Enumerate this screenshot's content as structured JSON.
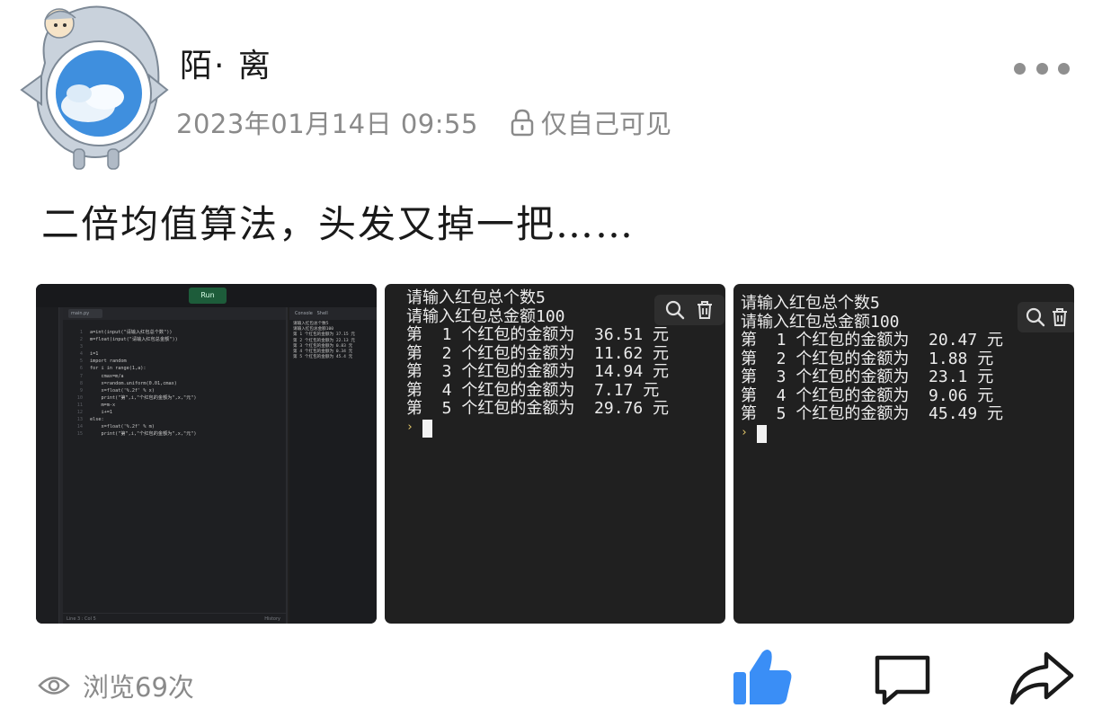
{
  "post": {
    "author": "陌· 离",
    "time": "2023年01月14日 09:55",
    "privacy": "仅自己可见",
    "text": "二倍均值算法，头发又掉一把……",
    "views": "浏览69次"
  },
  "images": {
    "ide": {
      "run_label": "Run",
      "tab": "main.py",
      "status_left": "Line 3 : Col 5",
      "status_right": "History",
      "console_tabs": "Console   Shell",
      "code_lines": [
        "a=int(input(\"请输入红包总个数\"))",
        "m=float(input(\"请输入红包总金额\"))",
        "",
        "i=1",
        "import random",
        "for i in range(1,a):",
        "    cmax=m/a",
        "    x=random.uniform(0.01,cmax)",
        "    x=float('%.2f' % x)",
        "    print(\"第\",i,\"个红包的金额为\",x,\"元\")",
        "    m=m-x",
        "    i+=1",
        "else:",
        "    x=float('%.2f' % m)",
        "    print(\"第\",i,\"个红包的金额为\",x,\"元\")"
      ],
      "console_lines": [
        "请输入红包总个数5",
        "请输入红包总金额100",
        "第 1 个红包的金额为 37.15 元",
        "第 2 个红包的金额为 22.13 元",
        "第 3 个红包的金额为 0.83 元",
        "第 4 个红包的金额为 0.34 元",
        "第 5 个红包的金额为 45.4 元"
      ]
    },
    "console_a": {
      "lines": [
        "请输入红包总个数5",
        "请输入红包总金额100",
        "第  1 个红包的金额为  36.51 元",
        "第  2 个红包的金额为  11.62 元",
        "第  3 个红包的金额为  14.94 元",
        "第  4 个红包的金额为  7.17 元",
        "第  5 个红包的金额为  29.76 元"
      ],
      "prompt": "›"
    },
    "console_b": {
      "lines": [
        "请输入红包总个数5",
        "请输入红包总金额100",
        "第  1 个红包的金额为  20.47 元",
        "第  2 个红包的金额为  1.88 元",
        "第  3 个红包的金额为  23.1 元",
        "第  4 个红包的金额为  9.06 元",
        "第  5 个红包的金额为  45.49 元"
      ],
      "prompt": "›"
    }
  },
  "icons": {
    "more": "more-dots-icon",
    "lock": "lock-icon",
    "eye": "eye-icon",
    "like": "thumbs-up-icon",
    "comment": "comment-icon",
    "share": "share-icon",
    "search": "search-icon",
    "trash": "trash-icon"
  },
  "colors": {
    "like_blue": "#3a8ef6",
    "meta_gray": "#8a8a8a",
    "console_bg": "#202020"
  }
}
